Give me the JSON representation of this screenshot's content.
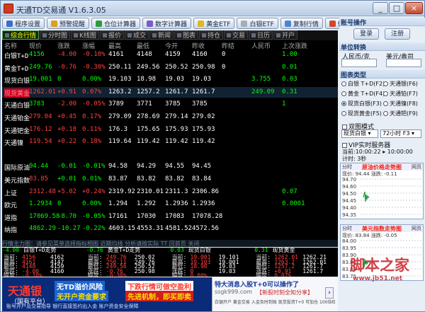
{
  "window": {
    "title": "天通TD交易通 V1.6.3.05",
    "min": "_",
    "max": "□",
    "close": "×"
  },
  "toolbar": [
    {
      "label": "程序设置",
      "icon": "gear-icon",
      "color": "#3b6fc4"
    },
    {
      "label": "预警提醒",
      "icon": "bell-icon",
      "color": "#d9a21a"
    },
    {
      "label": "仓位计算器",
      "icon": "calculator-icon",
      "color": "#2f9a3d"
    },
    {
      "label": "数字计算器",
      "icon": "calculator-icon",
      "color": "#7a5bc6"
    },
    {
      "label": "黄金ETF",
      "icon": "gold-icon",
      "color": "#e0b81e"
    },
    {
      "label": "白银ETF",
      "icon": "silver-icon",
      "color": "#a8aeb7"
    },
    {
      "label": "复制行情",
      "icon": "copy-icon",
      "color": "#4a87cf"
    },
    {
      "label": "快速链接",
      "icon": "link-icon",
      "color": "#d2472b"
    },
    {
      "label": "登录",
      "icon": "user-icon",
      "color": "#3c7d3c"
    }
  ],
  "tabs": [
    {
      "label": "综合行情",
      "active": true
    },
    {
      "label": "分时图"
    },
    {
      "label": "K线图"
    },
    {
      "label": "报价"
    },
    {
      "label": "成交"
    },
    {
      "label": "新闻"
    },
    {
      "label": "图表"
    },
    {
      "label": "持仓"
    },
    {
      "label": "交易"
    },
    {
      "label": "日历"
    },
    {
      "label": "开户"
    }
  ],
  "headers": [
    "名称",
    "现价",
    "涨跌",
    "涨幅",
    "最高",
    "最低",
    "今开",
    "昨收",
    "昨结",
    "人民币",
    "上次涨跌"
  ],
  "rows": [
    {
      "name": "白银T+D",
      "price": "4156",
      "chg": "-4.00",
      "pct": "-0.10%",
      "high": "4161",
      "low": "4148",
      "open": "4159",
      "prev": "4160",
      "settle": "0",
      "rmb": "",
      "last": "1.00",
      "pc": "#00ff00",
      "nc": "#ff4040"
    },
    {
      "name": "黄金T+D",
      "price": "249.76",
      "chg": "-0.76",
      "pct": "-0.30%",
      "high": "250.11",
      "low": "249.56",
      "open": "250.52",
      "prev": "250.98",
      "settle": "0",
      "rmb": "",
      "last": "0.01",
      "pc": "#00ff00",
      "nc": "#ff4040"
    },
    {
      "name": "现货白银",
      "price": "19.001",
      "chg": "0",
      "pct": "0.00%",
      "high": "19.103",
      "low": "18.98",
      "open": "19.03",
      "prev": "19.03",
      "settle": "",
      "rmb": "3.755",
      "last": "0.03",
      "pc": "#00ff00",
      "nc": "#00ff00"
    },
    {
      "name": "现货黄金",
      "price": "1262.01",
      "chg": "+0.91",
      "pct": "0.07%",
      "high": "1263.2",
      "low": "1257.2",
      "open": "1261.7",
      "prev": "1261.7",
      "settle": "",
      "rmb": "249.09",
      "last": "0.31",
      "pc": "#ff4040",
      "nc": "#ff4040",
      "hl": true
    },
    {
      "name": "天通白银",
      "price": "3783",
      "chg": "-2.00",
      "pct": "-0.05%",
      "high": "3789",
      "low": "3771",
      "open": "3785",
      "prev": "3785",
      "settle": "",
      "rmb": "",
      "last": "1",
      "pc": "#00ff00",
      "nc": "#ff4040"
    },
    {
      "name": "天通铂金",
      "price": "279.04",
      "chg": "+0.45",
      "pct": "0.17%",
      "high": "279.09",
      "low": "278.69",
      "open": "279.14",
      "prev": "279.02",
      "settle": "",
      "rmb": "",
      "last": "",
      "pc": "#ff4040",
      "nc": "#ff4040"
    },
    {
      "name": "天通钯金",
      "price": "176.12",
      "chg": "+0.18",
      "pct": "0.11%",
      "high": "176.3",
      "low": "175.65",
      "open": "175.93",
      "prev": "175.93",
      "settle": "",
      "rmb": "",
      "last": "",
      "pc": "#ff4040",
      "nc": "#ff4040"
    },
    {
      "name": "天通镍",
      "price": "119.54",
      "chg": "+0.22",
      "pct": "0.18%",
      "high": "119.64",
      "low": "119.42",
      "open": "119.42",
      "prev": "119.42",
      "settle": "",
      "rmb": "",
      "last": "",
      "pc": "#ff4040",
      "nc": "#ff4040"
    },
    {
      "name": "",
      "price": "",
      "chg": "",
      "pct": "",
      "high": "",
      "low": "",
      "open": "",
      "prev": "",
      "settle": "",
      "rmb": "",
      "last": "",
      "pc": "#fff",
      "nc": "#fff"
    },
    {
      "name": "国际原油",
      "price": "94.44",
      "chg": "-0.01",
      "pct": "-0.01%",
      "high": "94.58",
      "low": "94.29",
      "open": "94.55",
      "prev": "94.45",
      "settle": "",
      "rmb": "",
      "last": "",
      "pc": "#00ff00",
      "nc": "#00ff00"
    },
    {
      "name": "美元指数",
      "price": "83.85",
      "chg": "+0.01",
      "pct": "0.01%",
      "high": "83.87",
      "low": "83.82",
      "open": "83.82",
      "prev": "83.84",
      "settle": "",
      "rmb": "",
      "last": "",
      "pc": "#ff4040",
      "nc": "#00ff00"
    },
    {
      "name": "上证",
      "price": "2312.48",
      "chg": "+5.02",
      "pct": "+0.24%",
      "high": "2319.92",
      "low": "2310.01",
      "open": "2311.3",
      "prev": "2306.86",
      "settle": "",
      "rmb": "",
      "last": "0.07",
      "pc": "#ff4040",
      "nc": "#ff4040"
    },
    {
      "name": "欧元",
      "price": "1.2934",
      "chg": "0",
      "pct": "0.00%",
      "high": "1.294",
      "low": "1.292",
      "open": "1.2936",
      "prev": "1.2936",
      "settle": "",
      "rmb": "",
      "last": "0.0001",
      "pc": "#00ff00",
      "nc": "#00ff00"
    },
    {
      "name": "道指",
      "price": "17069.58",
      "chg": "-8.70",
      "pct": "-0.05%",
      "high": "17161",
      "low": "17030",
      "open": "17083",
      "prev": "17078.28",
      "settle": "",
      "rmb": "",
      "last": "",
      "pc": "#00ff00",
      "nc": "#00ff00"
    },
    {
      "name": "纳指",
      "price": "4862.29",
      "chg": "-10.27",
      "pct": "-0.22%",
      "high": "4603.15",
      "low": "4553.31",
      "open": "4581.52",
      "prev": "4572.56",
      "settle": "",
      "rmb": "",
      "last": "",
      "pc": "#00ff00",
      "nc": "#00ff00"
    }
  ],
  "statusbar": "行情主力图：请参见菜单选择指标相图 近期均线 分析请按实际 TT 回首页 关闭",
  "panels": [
    {
      "title": "白银T+D走势",
      "change": "-4.00",
      "lines": [
        [
          "当前:",
          "4156",
          "4162"
        ],
        [
          "最高:",
          "4161",
          "4147"
        ],
        [
          "最低:",
          "4148",
          "4159"
        ],
        [
          "涨跌:",
          "-4.00",
          "4160"
        ],
        [
          "幅度:",
          "-0.10%",
          ""
        ]
      ]
    },
    {
      "title": "黄金T+D走势",
      "change": "-0.76",
      "lines": [
        [
          "当前:",
          "249.76",
          "250.02"
        ],
        [
          "最高:",
          "250.11",
          "249.76"
        ],
        [
          "最低:",
          "249.56",
          "250.52"
        ],
        [
          "涨跌:",
          "-0.76",
          "250.98"
        ],
        [
          "幅度:",
          "-0.30%",
          ""
        ]
      ]
    },
    {
      "title": "现货白银",
      "change": "0.03",
      "lines": [
        [
          "当前:",
          "19.001",
          "19.101"
        ],
        [
          "最高:",
          "19.103",
          "19.001"
        ],
        [
          "最低:",
          "18.98",
          "19.03"
        ],
        [
          "涨跌:",
          "0",
          "19.03"
        ],
        [
          "幅度:",
          "0.00%",
          ""
        ]
      ]
    },
    {
      "title": "现货黄金",
      "change": "0.31",
      "lines": [
        [
          "当前:",
          "1262.01",
          "1262.21"
        ],
        [
          "最高:",
          "1263.2",
          "1262.01"
        ],
        [
          "最低:",
          "1257.2",
          "1261.7"
        ],
        [
          "涨跌:",
          "+0.91",
          "1261.7"
        ],
        [
          "幅度:",
          "0.07%",
          ""
        ]
      ]
    }
  ],
  "ad": {
    "brand": "天通银",
    "brand_sub": "（国有平台）",
    "l1": "无TD溢价风险",
    "l2": "无开户资金要求",
    "r1": "下跌行情可做空盈利",
    "r2": "先进机制，即买即卖",
    "bottom": "账号开户及交易指导   银行直接签约出入金   账户资金安全保障",
    "side_title": "特大消息入股T+0可以操作了",
    "side_site": "ssgk999.com",
    "side_link": "【新股时刻全知分享】",
    "side_text": "白银开户  黄金交易  入金及时到账  现货投资T+0 可加仓 100倍杠杆"
  },
  "right": {
    "account_title": "账号操作",
    "login": "登录",
    "logout": "注册",
    "convert_title": "单位转换",
    "unit_left": "人民币/克",
    "unit_right": "美元/盎司",
    "chart_title": "图表类型",
    "options": [
      {
        "label": "白银 T+D(F2)",
        "on": false
      },
      {
        "label": "天通银(F6)",
        "on": false
      },
      {
        "label": "黄金 T+D(F4)",
        "on": false
      },
      {
        "label": "天通铂(F7)",
        "on": false
      },
      {
        "label": "现货白银(F3)",
        "on": true
      },
      {
        "label": "天通镍(F8)",
        "on": false
      },
      {
        "label": "现货黄金(F5)",
        "on": false
      },
      {
        "label": "天通钯(F9)",
        "on": false
      }
    ],
    "combo_label": "双图模式",
    "sel1": "现货白银",
    "sel2": "72小时 F3",
    "vip": "VIP实时服务器",
    "time_label": "当前:",
    "time1": "10:00:22",
    "time2": "10:00:00",
    "interval": "计时: 3秒",
    "tab_left": "分时",
    "chart1_title": "原油价格走势图",
    "chart1_tab": "网页",
    "chart1_info": "现价: 94.44   涨跌: -0.11",
    "chart1_y": [
      "94.70",
      "94.60",
      "94.50",
      "94.45",
      "94.40",
      "94.35"
    ],
    "chart2_title": "美元指数走势图",
    "chart2_tab": "网页",
    "chart2_info": "现价: 83.84   涨跌: -0.05",
    "chart2_y": [
      "84.00",
      "83.95",
      "83.90",
      "83.85",
      "83.80",
      "83.75"
    ]
  },
  "watermark": {
    "cn": "脚本之家",
    "url": "www.jb51.net"
  }
}
